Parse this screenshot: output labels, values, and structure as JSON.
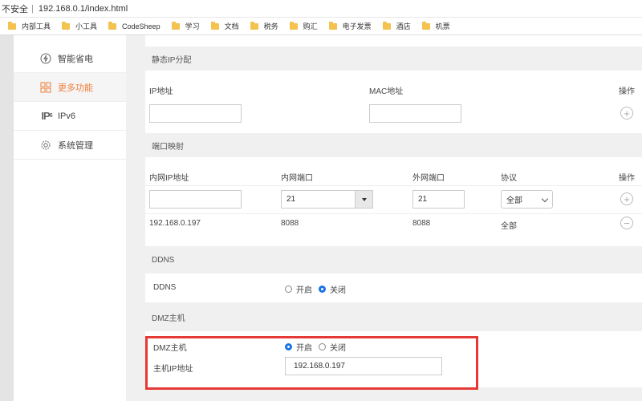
{
  "browser": {
    "security_label": "不安全",
    "separator": "|",
    "url": "192.168.0.1/index.html",
    "bookmarks": [
      "内部工具",
      "小工具",
      "CodeSheep",
      "学习",
      "文档",
      "税务",
      "购汇",
      "电子发票",
      "酒店",
      "机票"
    ]
  },
  "sidebar": {
    "items": [
      {
        "label": "智能省电",
        "icon": "power-icon"
      },
      {
        "label": "更多功能",
        "icon": "grid-icon",
        "active": true
      },
      {
        "label": "IPv6",
        "icon": "ipv6-icon"
      },
      {
        "label": "系统管理",
        "icon": "gear-icon"
      }
    ]
  },
  "static_ip": {
    "title": "静态IP分配",
    "col_ip": "IP地址",
    "col_mac": "MAC地址",
    "col_action": "操作",
    "ip_value": "",
    "mac_value": ""
  },
  "port_map": {
    "title": "端口映射",
    "col_lan_ip": "内网IP地址",
    "col_lan_port": "内网端口",
    "col_wan_port": "外网端口",
    "col_protocol": "协议",
    "col_action": "操作",
    "new_row": {
      "lan_ip": "",
      "lan_port": "21",
      "wan_port": "21",
      "protocol": "全部"
    },
    "rows": [
      {
        "lan_ip": "192.168.0.197",
        "lan_port": "8088",
        "wan_port": "8088",
        "protocol": "全部"
      }
    ]
  },
  "ddns": {
    "title": "DDNS",
    "label": "DDNS",
    "on_label": "开启",
    "off_label": "关闭",
    "selected": "off"
  },
  "dmz": {
    "title": "DMZ主机",
    "label": "DMZ主机",
    "on_label": "开启",
    "off_label": "关闭",
    "selected": "on",
    "host_ip_label": "主机IP地址",
    "host_ip": "192.168.0.197"
  },
  "colors": {
    "accent": "#f0803c",
    "radio": "#1a73e8",
    "highlight": "#e53935"
  }
}
